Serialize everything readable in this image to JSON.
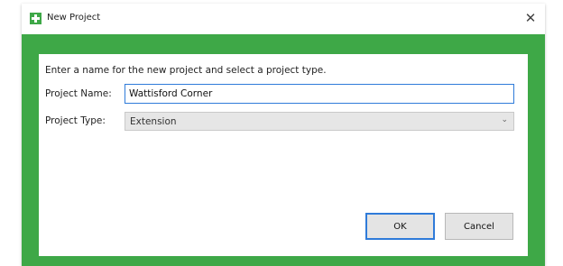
{
  "window": {
    "title": "New Project",
    "icon": "green-plus-icon",
    "close_glyph": "✕",
    "accent_color": "#3ea847"
  },
  "form": {
    "instruction": "Enter a name for the new project and select a project type.",
    "name_label": "Project Name:",
    "name_value": "Wattisford Corner",
    "type_label": "Project Type:",
    "type_value": "Extension",
    "dropdown_icon": "chevron-down-icon"
  },
  "buttons": {
    "ok_label": "OK",
    "cancel_label": "Cancel"
  }
}
